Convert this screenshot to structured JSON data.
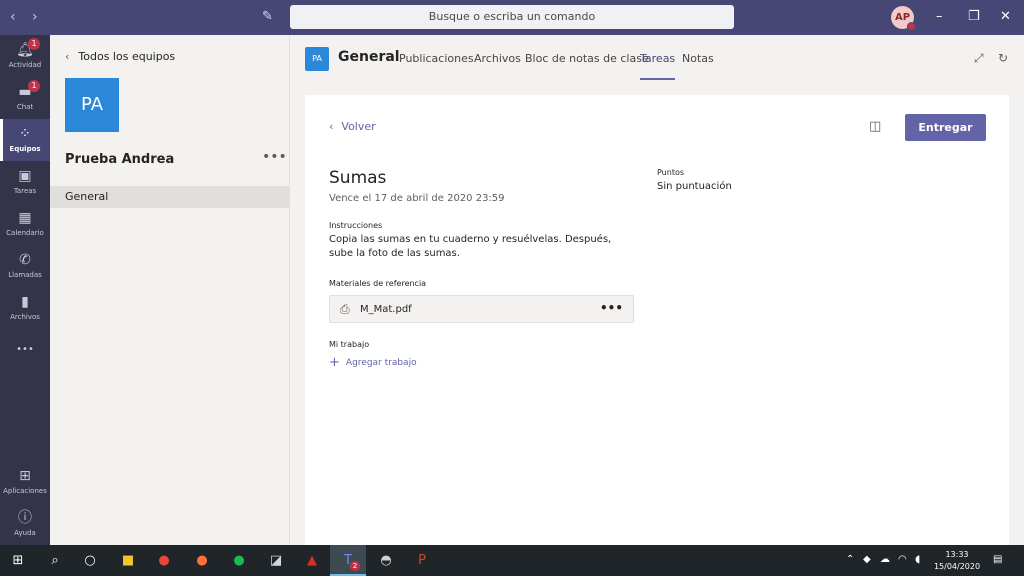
{
  "titlebar": {
    "search_placeholder": "Busque o escriba un comando",
    "avatar_initials": "AP",
    "minimize": "–",
    "maximize": "❐",
    "close": "✕"
  },
  "rail": {
    "items": [
      {
        "label": "Actividad",
        "icon": "bell-icon",
        "badge": "1"
      },
      {
        "label": "Chat",
        "icon": "chat-icon",
        "badge": "1"
      },
      {
        "label": "Equipos",
        "icon": "teams-icon"
      },
      {
        "label": "Tareas",
        "icon": "assignments-icon"
      },
      {
        "label": "Calendario",
        "icon": "calendar-icon"
      },
      {
        "label": "Llamadas",
        "icon": "phone-icon"
      },
      {
        "label": "Archivos",
        "icon": "file-icon"
      },
      {
        "label": "•••",
        "icon": "more-icon"
      },
      {
        "label": "Aplicaciones",
        "icon": "apps-icon"
      },
      {
        "label": "Ayuda",
        "icon": "help-icon"
      }
    ]
  },
  "teams_panel": {
    "back_label": "Todos los equipos",
    "team_initials": "PA",
    "team_name": "Prueba Andrea",
    "more": "•••",
    "channels": [
      "General"
    ]
  },
  "header": {
    "channel_initials": "PA",
    "channel_name": "General",
    "tabs": [
      "Publicaciones",
      "Archivos",
      "Bloc de notas de clase",
      "Tareas",
      "Notas"
    ],
    "active_tab": "Tareas"
  },
  "assignment": {
    "back_label": "Volver",
    "submit_label": "Entregar",
    "title": "Sumas",
    "due": "Vence el 17 de abril de 2020 23:59",
    "instructions_label": "Instrucciones",
    "instructions_text": "Copia las sumas en tu cuaderno y resuélvelas. Después, sube la foto de las sumas.",
    "reference_label": "Materiales de referencia",
    "reference_file": "M_Mat.pdf",
    "points_label": "Puntos",
    "points_value": "Sin puntuación",
    "my_work_label": "Mi trabajo",
    "add_work_label": "Agregar trabajo"
  },
  "taskbar": {
    "clock_time": "13:33",
    "clock_date": "15/04/2020",
    "teams_badge": "2"
  },
  "colors": {
    "accent": "#6264a7",
    "titlebar": "#464775",
    "rail": "#33344a",
    "team_tile": "#2b88d8",
    "badge": "#c4314b"
  }
}
